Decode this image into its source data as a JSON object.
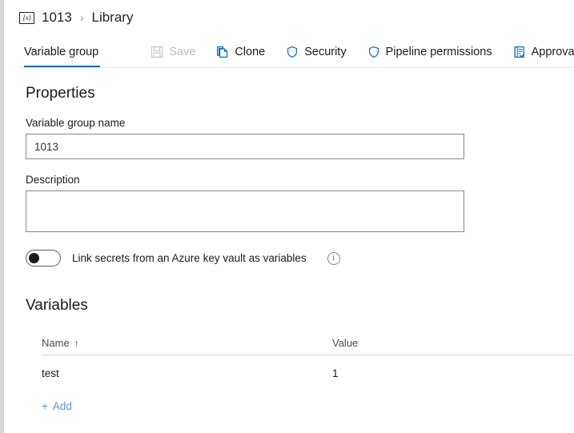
{
  "breadcrumb": {
    "icon": "variable-group-icon",
    "icon_glyph": "{x}",
    "group_name": "1013",
    "separator": "›",
    "parent": "Library"
  },
  "toolbar": {
    "tab_label": "Variable group",
    "save_label": "Save",
    "clone_label": "Clone",
    "security_label": "Security",
    "pipeline_permissions_label": "Pipeline permissions",
    "approvals_label": "Approvals and c",
    "accent_color": "#0b6cbd",
    "disabled_color": "#bdbdbd"
  },
  "properties": {
    "title": "Properties",
    "name_label": "Variable group name",
    "name_value": "1013",
    "name_placeholder": "",
    "description_label": "Description",
    "description_value": "",
    "description_placeholder": "",
    "keyvault_toggle_label": "Link secrets from an Azure key vault as variables",
    "keyvault_toggle_state": "off",
    "info_glyph": "i"
  },
  "variables": {
    "title": "Variables",
    "columns": [
      "Name",
      "Value"
    ],
    "sort_column": "Name",
    "sort_arrow": "↑",
    "rows": [
      {
        "name": "test",
        "value": "1"
      }
    ],
    "add_label": "Add",
    "add_glyph": "+"
  }
}
